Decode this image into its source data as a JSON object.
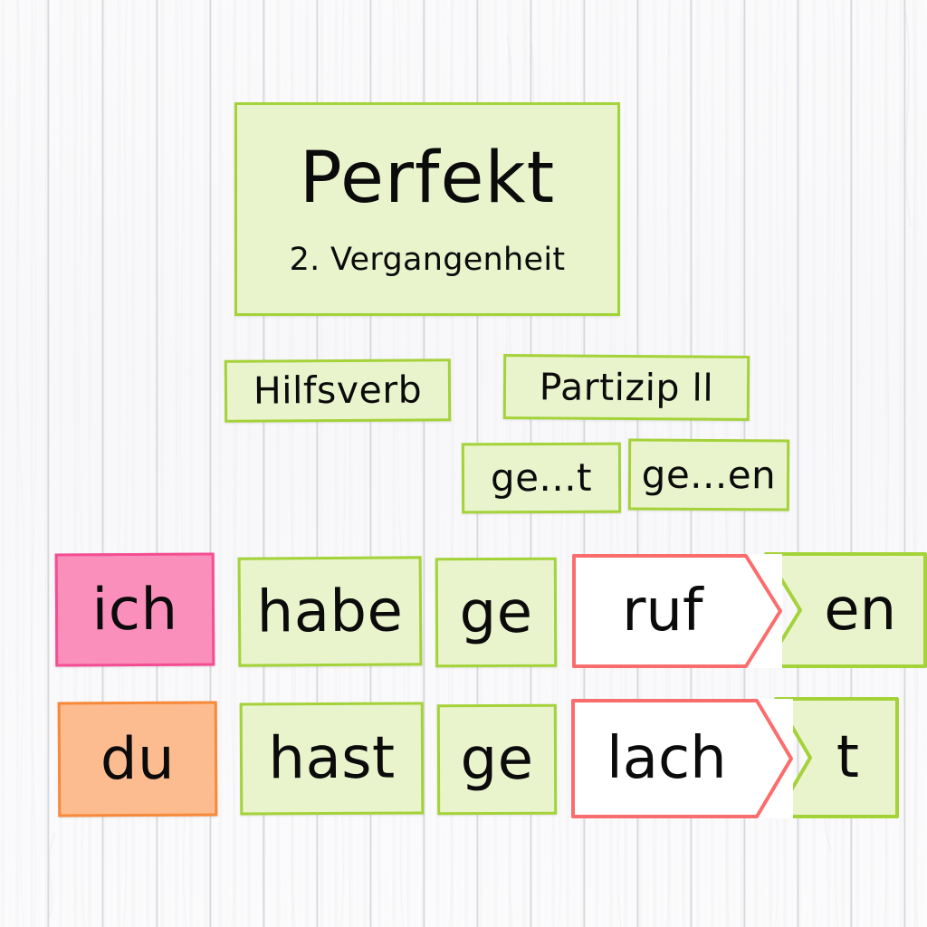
{
  "board": {
    "background_style": "white wood planks",
    "plank_seam_color": "#ced0d4"
  },
  "palette": {
    "card_green_fill": "#e9f4cd",
    "card_green_border": "#a4d239",
    "card_pink_fill": "#fb8fbc",
    "card_pink_border": "#f44e93",
    "card_orange_fill": "#fcbc8f",
    "card_orange_border": "#f7893a",
    "card_white_fill": "#ffffff",
    "card_red_border": "#fb6d6d",
    "text_color": "#0b0b0b"
  },
  "title_card": {
    "headline": "Perfekt",
    "subline": "2. Vergangenheit",
    "watermark": "·"
  },
  "structure_row": {
    "aux_label": "Hilfsverb",
    "participle_label": "Partizip ll"
  },
  "pattern_row": {
    "weak_pattern": "ge...t",
    "strong_pattern": "ge...en"
  },
  "examples": [
    {
      "pronoun": "ich",
      "pronoun_color": "pink",
      "auxiliary": "habe",
      "prefix": "ge",
      "stem": "ruf",
      "ending": "en"
    },
    {
      "pronoun": "du",
      "pronoun_color": "orange",
      "auxiliary": "hast",
      "prefix": "ge",
      "stem": "lach",
      "ending": "t"
    }
  ]
}
